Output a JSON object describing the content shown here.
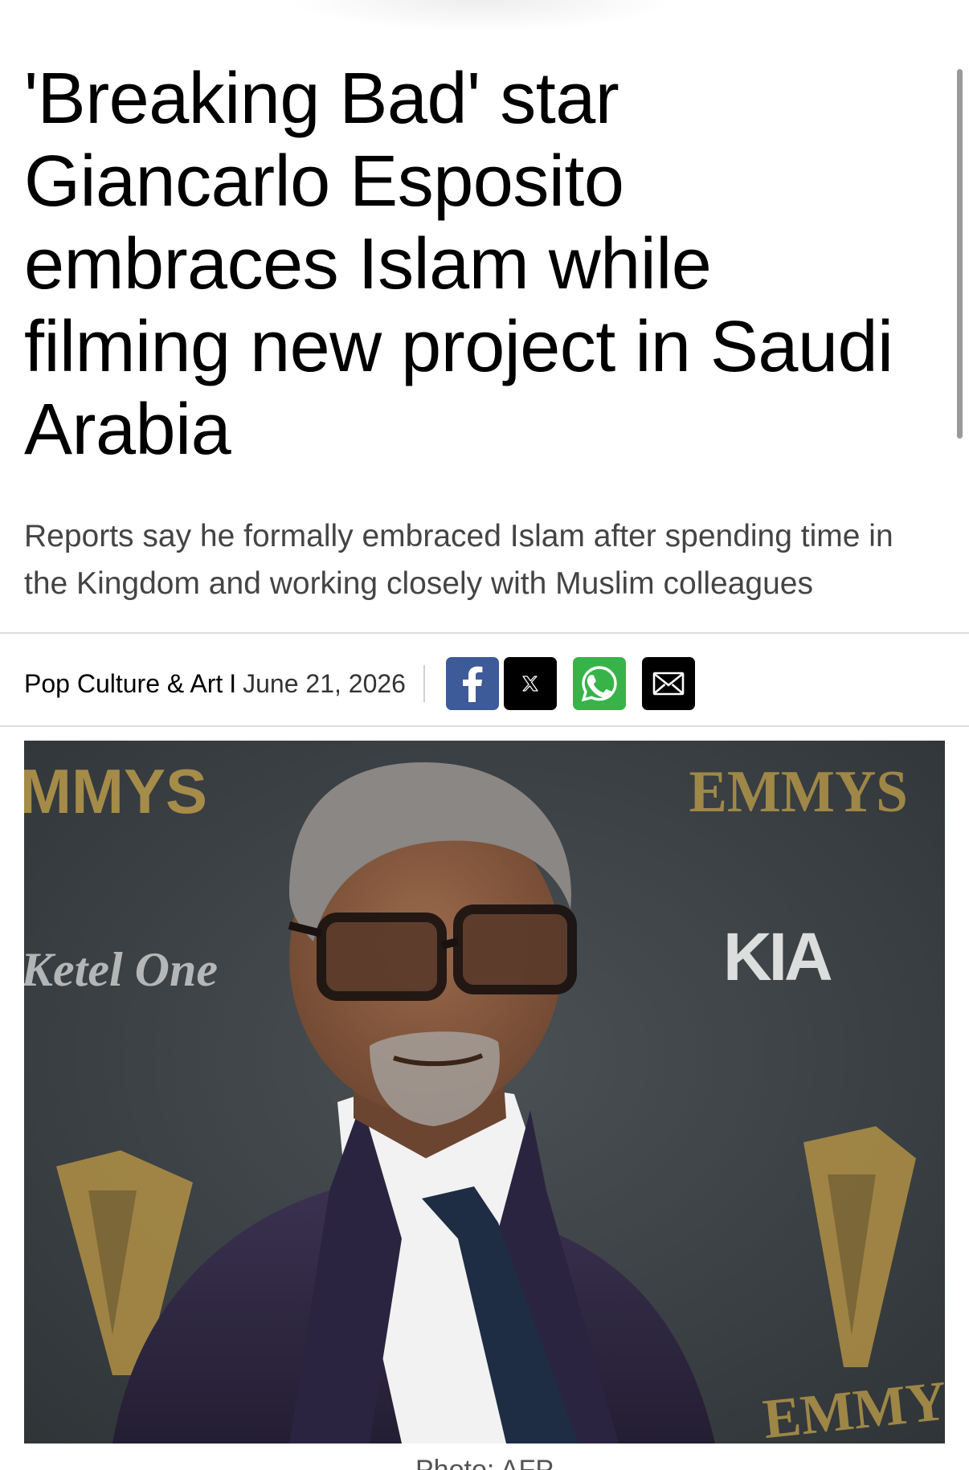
{
  "article": {
    "headline": "'Breaking Bad' star Giancarlo Esposito embraces Islam while filming new project in Saudi Arabia",
    "subheadline": "Reports say he formally embraced Islam after spending time in the Kingdom and working closely with Muslim colleagues",
    "category": "Pop Culture & Art",
    "separator": "I",
    "date": "June 21, 2026",
    "caption": "Photo: AFP"
  },
  "share": {
    "buttons": [
      {
        "name": "facebook",
        "icon": "facebook-icon",
        "color": "#3d5a99"
      },
      {
        "name": "x",
        "icon": "x-icon",
        "color": "#000000"
      },
      {
        "name": "whatsapp",
        "icon": "whatsapp-icon",
        "color": "#38b34a"
      },
      {
        "name": "email",
        "icon": "mail-icon",
        "color": "#000000"
      }
    ]
  },
  "photo": {
    "backdrop_text": [
      "MMYS",
      "EMMYS",
      "Ketel One",
      "KIA",
      "EMMYS"
    ],
    "colors": {
      "backdrop": "#3b4044",
      "gold": "#c9a54a",
      "suit": "#2e2740"
    }
  }
}
